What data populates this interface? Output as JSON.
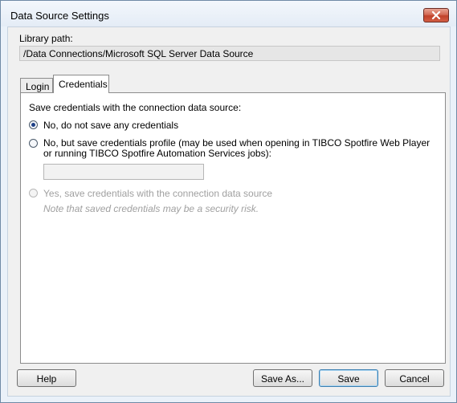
{
  "window": {
    "title": "Data Source Settings",
    "close_icon": "close-icon"
  },
  "library": {
    "label": "Library path:",
    "value": "/Data Connections/Microsoft SQL Server Data Source"
  },
  "tabs": [
    {
      "label": "Login",
      "selected": false
    },
    {
      "label": "Credentials",
      "selected": true
    }
  ],
  "credentials": {
    "section_label": "Save credentials with the connection data source:",
    "option1": "No, do not save any credentials",
    "option2_line1": "No, but save credentials profile (may be used when opening in TIBCO Spotfire Web Player",
    "option2_line2": "or running TIBCO Spotfire Automation Services jobs):",
    "profile_value": "",
    "option3": "Yes, save credentials with the connection data source",
    "note": "Note that saved credentials may be a security risk.",
    "selected_option": 1
  },
  "buttons": {
    "help": "Help",
    "save_as": "Save As...",
    "save": "Save",
    "cancel": "Cancel"
  },
  "colors": {
    "window_border": "#6f8aa6",
    "close_button": "#c0412a",
    "default_button_border": "#3c7fb1"
  }
}
